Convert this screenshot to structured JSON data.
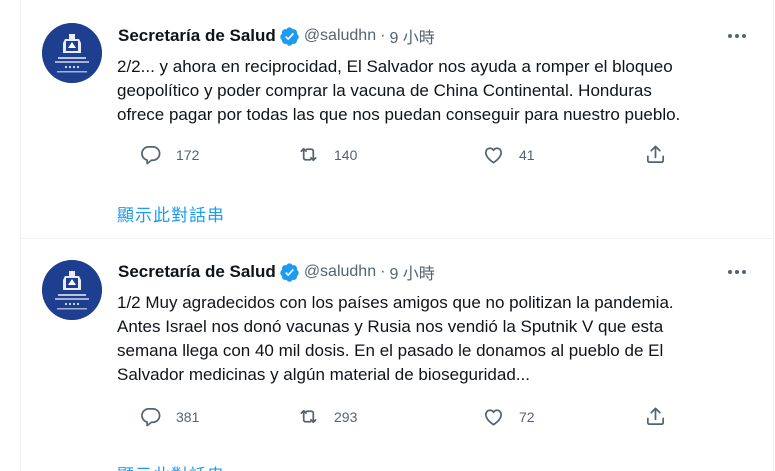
{
  "tweets": [
    {
      "author": "Secretaría de Salud",
      "handle": "@saludhn",
      "separator": "·",
      "time": "9 小時",
      "text": "2/2... y ahora en reciprocidad, El Salvador nos ayuda a romper el bloqueo\ngeopolítico y poder comprar la vacuna de China Continental. Honduras\nofrece pagar por todas las que nos puedan conseguir para nuestro pueblo.",
      "replies": "172",
      "retweets": "140",
      "likes": "41",
      "show_thread": "顯示此對話串"
    },
    {
      "author": "Secretaría de Salud",
      "handle": "@saludhn",
      "separator": "·",
      "time": "9 小時",
      "text": "1/2 Muy agradecidos con los países amigos que no politizan la pandemia.\nAntes Israel nos donó vacunas y Rusia nos vendió la Sputnik V que esta\nsemana llega con 40 mil dosis. En el pasado le donamos al pueblo de El\nSalvador medicinas y algún material de bioseguridad...",
      "replies": "381",
      "retweets": "293",
      "likes": "72",
      "show_thread": "顯示此對話串"
    }
  ],
  "icons": {
    "verified": "verified-badge-icon",
    "more": "more-horizontal-icon",
    "reply": "reply-icon",
    "retweet": "retweet-icon",
    "like": "heart-icon",
    "share": "share-icon"
  },
  "colors": {
    "accent": "#1d9bf0",
    "avatar_bg": "#1e3f8f",
    "secondary_text": "#536471"
  }
}
